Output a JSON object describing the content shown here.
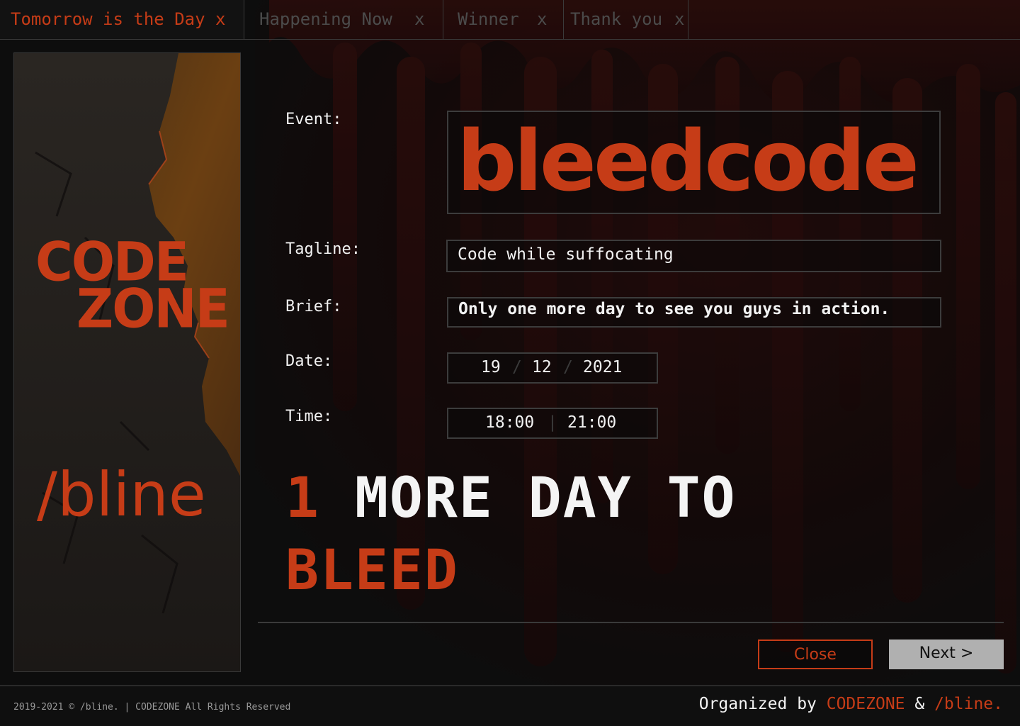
{
  "tabs": [
    {
      "label": "Tomorrow is the Day",
      "close": "x",
      "active": true
    },
    {
      "label": "Happening Now",
      "close": "x",
      "active": false
    },
    {
      "label": "Winner",
      "close": "x",
      "active": false
    },
    {
      "label": "Thank you",
      "close": "x",
      "active": false
    }
  ],
  "poster": {
    "logo_line1": "CODE",
    "logo_line2": "ZONE",
    "partner": "/bline"
  },
  "form": {
    "event_label": "Event:",
    "event_value": "bleedcode",
    "tagline_label": "Tagline:",
    "tagline_value": "Code while suffocating",
    "brief_label": "Brief:",
    "brief_value": "Only one more day to see you guys in action.",
    "date_label": "Date:",
    "date_day": "19",
    "date_month": "12",
    "date_year": "2021",
    "date_sep": "/",
    "time_label": "Time:",
    "time_start": "18:00",
    "time_end": "21:00",
    "time_sep": "|"
  },
  "headline": {
    "count": "1",
    "middle": "MORE DAY TO",
    "last": "BLEED"
  },
  "buttons": {
    "close": "Close",
    "next": "Next >"
  },
  "footer": {
    "copyright": "2019-2021 © /bline. | CODEZONE All Rights Reserved",
    "organized_prefix": "Organized by ",
    "org1": "CODEZONE",
    "amp": " & ",
    "org2": "/bline."
  },
  "colors": {
    "accent": "#c63c17",
    "background": "#0d0d0d",
    "border": "#3a3a3a",
    "next_button": "#b0b0b0"
  }
}
